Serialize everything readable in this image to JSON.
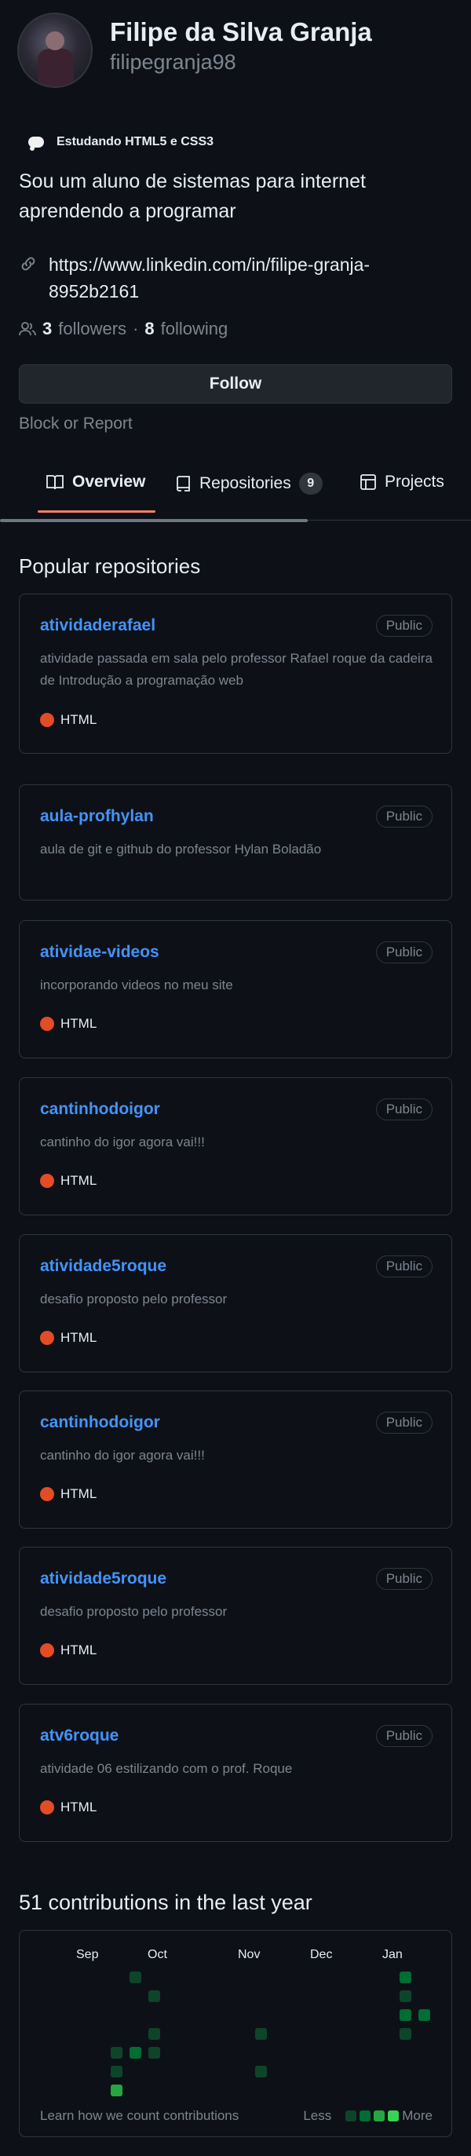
{
  "profile": {
    "name": "Filipe da Silva Granja",
    "login": "filipegranja98",
    "status": "Estudando HTML5 e CSS3",
    "status_icon": "speech-balloon-icon",
    "bio": "Sou um aluno de sistemas para internet aprendendo a programar",
    "link": "https://www.linkedin.com/in/filipe-granja-8952b2161",
    "followers_count": "3",
    "followers_label": "followers",
    "separator": "·",
    "following_count": "8",
    "following_label": "following",
    "follow_button": "Follow",
    "block_report": "Block or Report"
  },
  "tabs": [
    {
      "label": "Overview",
      "icon": "book-icon"
    },
    {
      "label": "Repositories",
      "icon": "repo-icon",
      "count": "9"
    },
    {
      "label": "Projects",
      "icon": "table-icon"
    }
  ],
  "popular": {
    "title": "Popular repositories",
    "repos": [
      {
        "name": "atividaderafael",
        "visibility": "Public",
        "description": "atividade passada em sala pelo professor Rafael roque da cadeira de Introdução a programação web",
        "language": "HTML"
      },
      {
        "name": "aula-profhylan",
        "visibility": "Public",
        "description": "aula de git e github do professor Hylan Boladão",
        "language": ""
      },
      {
        "name": "atividae-videos",
        "visibility": "Public",
        "description": "incorporando videos no meu site",
        "language": "HTML"
      },
      {
        "name": "cantinhodoigor",
        "visibility": "Public",
        "description": "cantinho do igor agora vai!!!",
        "language": "HTML"
      },
      {
        "name": "atividade5roque",
        "visibility": "Public",
        "description": "desafio proposto pelo professor",
        "language": "HTML"
      },
      {
        "name": "cantinhodoigor",
        "visibility": "Public",
        "description": "cantinho do igor agora vai!!!",
        "language": "HTML"
      },
      {
        "name": "atividade5roque",
        "visibility": "Public",
        "description": "desafio proposto pelo professor",
        "language": "HTML"
      },
      {
        "name": "atv6roque",
        "visibility": "Public",
        "description": "atividade 06 estilizando com o prof. Roque",
        "language": "HTML"
      }
    ]
  },
  "contributions": {
    "title": "51 contributions in the last year",
    "months": [
      "Sep",
      "Oct",
      "Nov",
      "Dec",
      "Jan"
    ],
    "learn": "Learn how we count contributions",
    "less": "Less",
    "more": "More"
  },
  "colors": {
    "background": "#0d1117",
    "link": "#4493f8",
    "html": "#e34c26",
    "tab_underline": "#f78166",
    "levels": [
      "#161b22",
      "#0e4429",
      "#006d32",
      "#26a641",
      "#39d353"
    ]
  }
}
